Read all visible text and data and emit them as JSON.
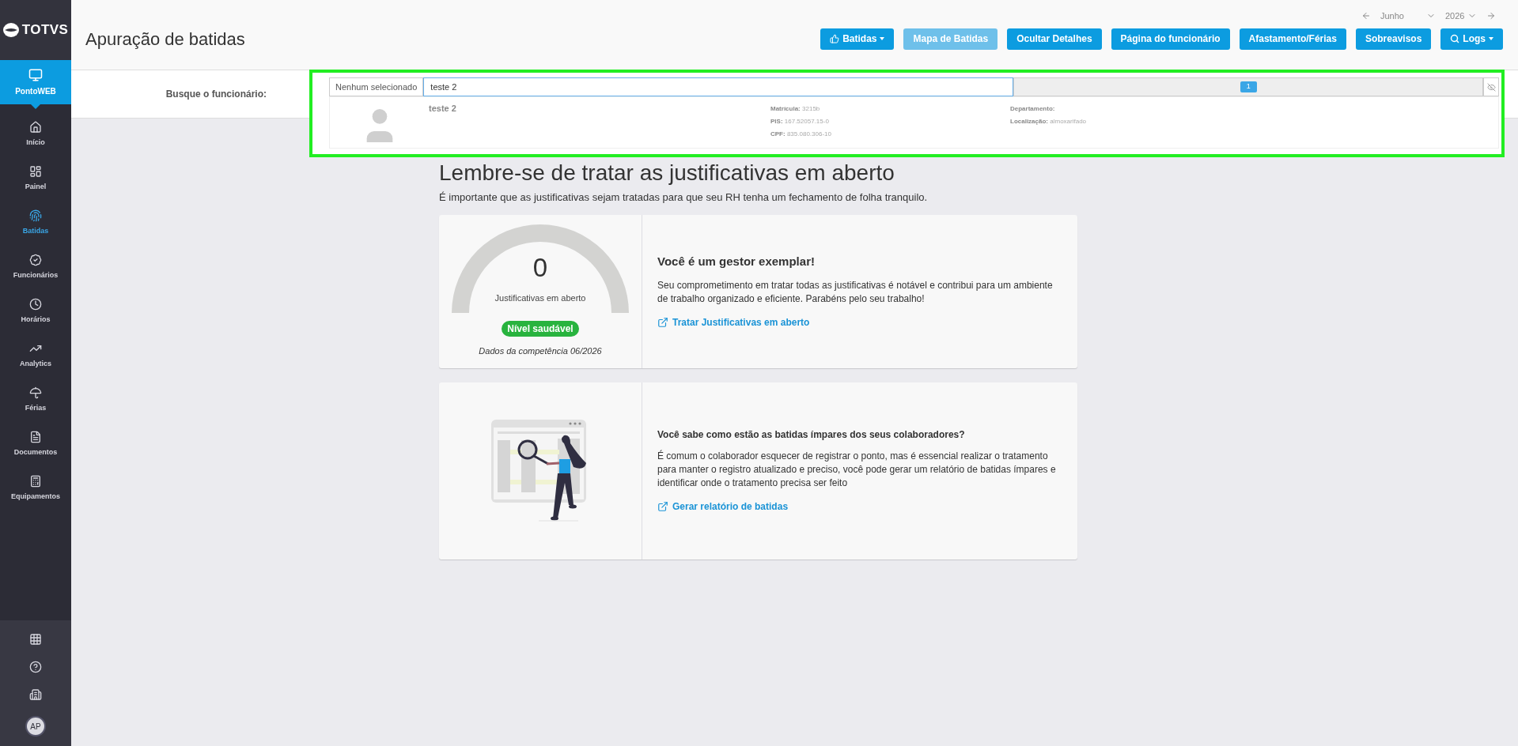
{
  "sidebar": {
    "logo": "TOTVS",
    "module": "PontoWEB",
    "items": [
      {
        "kind": "home",
        "label": "Início",
        "selected": false
      },
      {
        "kind": "panel",
        "label": "Painel",
        "selected": false
      },
      {
        "kind": "fingerprint",
        "label": "Batidas",
        "selected": true
      },
      {
        "kind": "badge",
        "label": "Funcionários",
        "selected": false
      },
      {
        "kind": "clock",
        "label": "Horários",
        "selected": false
      },
      {
        "kind": "trend",
        "label": "Analytics",
        "selected": false
      },
      {
        "kind": "umbrella",
        "label": "Férias",
        "selected": false
      },
      {
        "kind": "document",
        "label": "Documentos",
        "selected": false
      },
      {
        "kind": "device",
        "label": "Equipamentos",
        "selected": false
      }
    ],
    "avatar": "AP"
  },
  "period": {
    "month": "Junho",
    "year": "2026"
  },
  "page_title": "Apuração de batidas",
  "toolbar": [
    {
      "kind": "thumbs",
      "label": "Batidas",
      "caret": true,
      "disabled": false
    },
    {
      "label": "Mapa de Batidas",
      "disabled": true
    },
    {
      "label": "Ocultar Detalhes",
      "disabled": false
    },
    {
      "label": "Página do funcionário",
      "disabled": false
    },
    {
      "label": "Afastamento/Férias",
      "disabled": false
    },
    {
      "label": "Sobreavisos",
      "disabled": false
    },
    {
      "kind": "search",
      "label": "Logs",
      "caret": true,
      "disabled": false
    }
  ],
  "search": {
    "label": "Busque o funcionário:",
    "prefix": "Nenhum selecionado",
    "value": "teste 2",
    "count": "1",
    "result": {
      "name": "teste 2",
      "fields": [
        {
          "label": "Matrícula:",
          "value": "3215b"
        },
        {
          "label": "PIS:",
          "value": "167.52057.15-0"
        },
        {
          "label": "CPF:",
          "value": "835.080.306-10"
        }
      ],
      "fields_2": [
        {
          "label": "Departamento:"
        },
        {
          "label": "Localização:",
          "value": "almoxarifado"
        }
      ]
    }
  },
  "heading": "Lembre-se de tratar as justificativas em aberto",
  "subheading": "É importante que as justificativas sejam tratadas para que seu RH tenha um fechamento de folha tranquilo.",
  "cards": [
    {
      "kind": "gauge",
      "value": "0",
      "value_label": "Justificativas em aberto",
      "status": "Nível saudável",
      "note": "Dados da competência 06/2026",
      "title": "Você é um gestor exemplar!",
      "text": "Seu comprometimento em tratar todas as justificativas é notável e contribui para um ambiente de trabalho organizado e eficiente. Parabéns pelo seu trabalho!",
      "link": "Tratar Justificativas em aberto"
    },
    {
      "kind": "illustration",
      "title": "Você sabe como estão as batidas ímpares dos seus colaboradores?",
      "text": "É comum o colaborador esquecer de registrar o ponto, mas é essencial realizar o tratamento para manter o registro atualizado e preciso, você pode gerar um relatório de batidas ímpares e identificar onde o tratamento precisa ser feito",
      "link": "Gerar relatório de batidas"
    }
  ]
}
